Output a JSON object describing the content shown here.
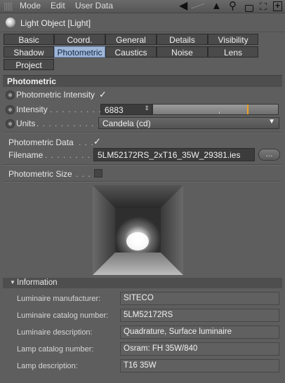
{
  "menu": {
    "mode": "Mode",
    "edit": "Edit",
    "user_data": "User Data"
  },
  "toolbar_icons": [
    "arrow-left-icon",
    "arrow-up-icon",
    "search-icon",
    "lock-icon",
    "hierarchy-icon",
    "add-panel-icon"
  ],
  "title": "Light Object [Light]",
  "tabs_row1": [
    "Basic",
    "Coord.",
    "General",
    "Details",
    "Visibility"
  ],
  "tabs_row2": [
    "Shadow",
    "Photometric",
    "Caustics",
    "Noise",
    "Lens"
  ],
  "tabs_row3": [
    "Project"
  ],
  "active_tab": "Photometric",
  "section_title": "Photometric",
  "photometric_intensity": {
    "label": "Photometric Intensity",
    "checked": "✓"
  },
  "intensity": {
    "label": "Intensity",
    "dots": ". . . . . . . . . . . .",
    "value": "6883",
    "slider_fraction": 0.75
  },
  "units": {
    "label": "Units",
    "dots": ". . . . . . . . . . . . . . .",
    "value": "Candela (cd)"
  },
  "photometric_data": {
    "label": "Photometric Data",
    "dots": ". . .",
    "checked": "✓"
  },
  "filename": {
    "label": "Filename",
    "dots": ". . . . . . . . . . .",
    "value": "5LM52172RS_2xT16_35W_29381.ies",
    "browse": "..."
  },
  "photometric_size": {
    "label": "Photometric Size",
    "dots": ". . ."
  },
  "info": {
    "title": "Information",
    "rows": [
      {
        "label": "Luminaire manufacturer:",
        "value": "SITECO"
      },
      {
        "label": "Luminaire catalog number:",
        "value": "5LM52172RS"
      },
      {
        "label": "Luminaire description:",
        "value": "Quadrature, Surface luminaire"
      },
      {
        "label": "Lamp catalog number:",
        "value": "Osram: FH 35W/840"
      },
      {
        "label": "Lamp description:",
        "value": "T16 35W"
      }
    ]
  }
}
